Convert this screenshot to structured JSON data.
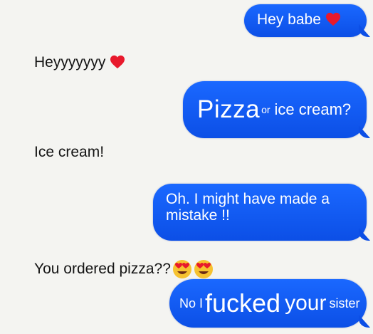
{
  "conversation": {
    "messages": [
      {
        "direction": "sent",
        "text": "Hey babe",
        "emoji": "red-heart"
      },
      {
        "direction": "received",
        "text": "Heyyyyyyy",
        "emoji": "red-heart"
      },
      {
        "direction": "sent",
        "parts": [
          "Pizza",
          "or",
          "ice cream?"
        ]
      },
      {
        "direction": "received",
        "text": "Ice cream!"
      },
      {
        "direction": "sent",
        "lines": [
          "Oh. I might have made a",
          "mistake !!"
        ]
      },
      {
        "direction": "received",
        "text": "You ordered pizza??",
        "emoji": "heart-eyes"
      },
      {
        "direction": "sent",
        "parts": [
          "No I",
          "fucked",
          "your",
          "sister"
        ]
      }
    ]
  },
  "colors": {
    "sent_bubble": "#1a68ff",
    "background": "#f4f4f1",
    "heart": "#e8192c"
  }
}
